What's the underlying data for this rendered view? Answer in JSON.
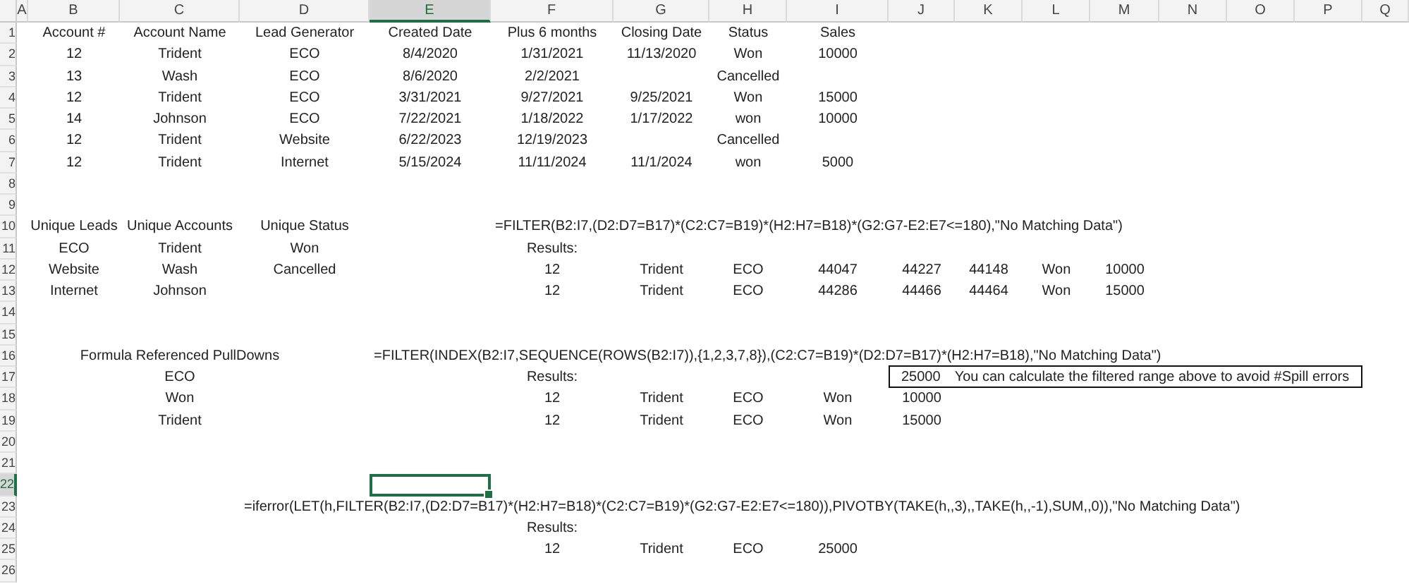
{
  "columns": [
    {
      "label": "A",
      "selected": false
    },
    {
      "label": "B",
      "selected": false
    },
    {
      "label": "C",
      "selected": false
    },
    {
      "label": "D",
      "selected": false
    },
    {
      "label": "E",
      "selected": true
    },
    {
      "label": "F",
      "selected": false
    },
    {
      "label": "G",
      "selected": false
    },
    {
      "label": "H",
      "selected": false
    },
    {
      "label": "I",
      "selected": false
    },
    {
      "label": "J",
      "selected": false
    },
    {
      "label": "K",
      "selected": false
    },
    {
      "label": "L",
      "selected": false
    },
    {
      "label": "M",
      "selected": false
    },
    {
      "label": "N",
      "selected": false
    },
    {
      "label": "O",
      "selected": false
    },
    {
      "label": "P",
      "selected": false
    },
    {
      "label": "Q",
      "selected": false
    }
  ],
  "rows": [
    {
      "label": "1",
      "selected": false,
      "cells": {
        "B": "Account #",
        "C": "Account Name",
        "D": "Lead Generator",
        "E": "Created Date",
        "F": "Plus 6 months",
        "G": "Closing Date",
        "H": "Status",
        "I": "Sales"
      }
    },
    {
      "label": "2",
      "selected": false,
      "cells": {
        "B": "12",
        "C": "Trident",
        "D": "ECO",
        "E": "8/4/2020",
        "F": "1/31/2021",
        "G": "11/13/2020",
        "H": "Won",
        "I": "10000"
      }
    },
    {
      "label": "3",
      "selected": false,
      "cells": {
        "B": "13",
        "C": "Wash",
        "D": "ECO",
        "E": "8/6/2020",
        "F": "2/2/2021",
        "H": "Cancelled"
      }
    },
    {
      "label": "4",
      "selected": false,
      "cells": {
        "B": "12",
        "C": "Trident",
        "D": "ECO",
        "E": "3/31/2021",
        "F": "9/27/2021",
        "G": "9/25/2021",
        "H": "Won",
        "I": "15000"
      }
    },
    {
      "label": "5",
      "selected": false,
      "cells": {
        "B": "14",
        "C": "Johnson",
        "D": "ECO",
        "E": "7/22/2021",
        "F": "1/18/2022",
        "G": "1/17/2022",
        "H": "won",
        "I": "10000"
      }
    },
    {
      "label": "6",
      "selected": false,
      "cells": {
        "B": "12",
        "C": "Trident",
        "D": "Website",
        "E": "6/22/2023",
        "F": "12/19/2023",
        "H": "Cancelled"
      }
    },
    {
      "label": "7",
      "selected": false,
      "cells": {
        "B": "12",
        "C": "Trident",
        "D": "Internet",
        "E": "5/15/2024",
        "F": "11/11/2024",
        "G": "11/1/2024",
        "H": "won",
        "I": "5000"
      }
    },
    {
      "label": "8",
      "selected": false
    },
    {
      "label": "9",
      "selected": false
    },
    {
      "label": "10",
      "selected": false,
      "cells": {
        "B": "Unique Leads",
        "C": "Unique Accounts",
        "D": "Unique Status"
      },
      "formula": {
        "F": "=FILTER(B2:I7,(D2:D7=B17)*(C2:C7=B19)*(H2:H7=B18)*(G2:G7-E2:E7<=180),\"No Matching Data\")"
      }
    },
    {
      "label": "11",
      "selected": false,
      "cells": {
        "B": "ECO",
        "C": "Trident",
        "D": "Won",
        "F": "Results:"
      }
    },
    {
      "label": "12",
      "selected": false,
      "cells": {
        "B": "Website",
        "C": "Wash",
        "D": "Cancelled",
        "F": "12",
        "G": "Trident",
        "H": "ECO",
        "I": "44047",
        "J": "44227",
        "K": "44148",
        "L": "Won",
        "M": "10000"
      }
    },
    {
      "label": "13",
      "selected": false,
      "cells": {
        "B": "Internet",
        "C": "Johnson",
        "F": "12",
        "G": "Trident",
        "H": "ECO",
        "I": "44286",
        "J": "44466",
        "K": "44464",
        "L": "Won",
        "M": "15000"
      }
    },
    {
      "label": "14",
      "selected": false
    },
    {
      "label": "15",
      "selected": false
    },
    {
      "label": "16",
      "selected": false,
      "cells": {
        "C": "Formula Referenced PullDowns"
      },
      "formula": {
        "E": "=FILTER(INDEX(B2:I7,SEQUENCE(ROWS(B2:I7)),{1,2,3,7,8}),(C2:C7=B19)*(D2:D7=B17)*(H2:H7=B18),\"No Matching Data\")"
      }
    },
    {
      "label": "17",
      "selected": false,
      "cells": {
        "C": "ECO",
        "F": "Results:"
      },
      "note": {
        "value": "25000",
        "text": "You can calculate the filtered range above to avoid #Spill errors"
      }
    },
    {
      "label": "18",
      "selected": false,
      "cells": {
        "C": "Won",
        "F": "12",
        "G": "Trident",
        "H": "ECO",
        "I": "Won",
        "J": "10000"
      }
    },
    {
      "label": "19",
      "selected": false,
      "cells": {
        "C": "Trident",
        "F": "12",
        "G": "Trident",
        "H": "ECO",
        "I": "Won",
        "J": "15000"
      }
    },
    {
      "label": "20",
      "selected": false
    },
    {
      "label": "21",
      "selected": false
    },
    {
      "label": "22",
      "selected": true
    },
    {
      "label": "23",
      "selected": false,
      "formula": {
        "D": "=iferror(LET(h,FILTER(B2:I7,(D2:D7=B17)*(H2:H7=B18)*(C2:C7=B19)*(G2:G7-E2:E7<=180)),PIVOTBY(TAKE(h,,3),,TAKE(h,,-1),SUM,,0)),\"No Matching Data\")"
      }
    },
    {
      "label": "24",
      "selected": false,
      "cells": {
        "F": "Results:"
      }
    },
    {
      "label": "25",
      "selected": false,
      "cells": {
        "F": "12",
        "G": "Trident",
        "H": "ECO",
        "I": "25000"
      }
    },
    {
      "label": "26",
      "selected": false
    }
  ]
}
